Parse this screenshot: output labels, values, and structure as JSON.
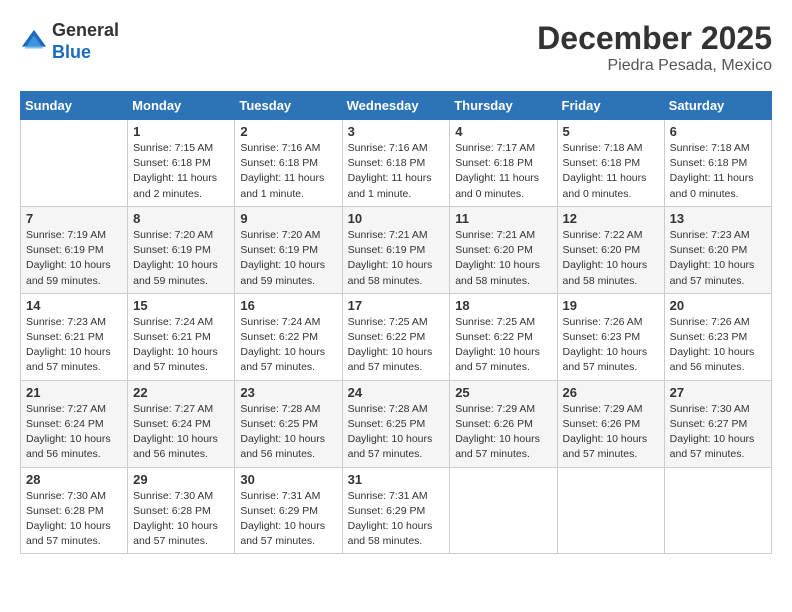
{
  "logo": {
    "general": "General",
    "blue": "Blue"
  },
  "title": "December 2025",
  "location": "Piedra Pesada, Mexico",
  "days_header": [
    "Sunday",
    "Monday",
    "Tuesday",
    "Wednesday",
    "Thursday",
    "Friday",
    "Saturday"
  ],
  "weeks": [
    [
      {
        "day": "",
        "info": ""
      },
      {
        "day": "1",
        "info": "Sunrise: 7:15 AM\nSunset: 6:18 PM\nDaylight: 11 hours\nand 2 minutes."
      },
      {
        "day": "2",
        "info": "Sunrise: 7:16 AM\nSunset: 6:18 PM\nDaylight: 11 hours\nand 1 minute."
      },
      {
        "day": "3",
        "info": "Sunrise: 7:16 AM\nSunset: 6:18 PM\nDaylight: 11 hours\nand 1 minute."
      },
      {
        "day": "4",
        "info": "Sunrise: 7:17 AM\nSunset: 6:18 PM\nDaylight: 11 hours\nand 0 minutes."
      },
      {
        "day": "5",
        "info": "Sunrise: 7:18 AM\nSunset: 6:18 PM\nDaylight: 11 hours\nand 0 minutes."
      },
      {
        "day": "6",
        "info": "Sunrise: 7:18 AM\nSunset: 6:18 PM\nDaylight: 11 hours\nand 0 minutes."
      }
    ],
    [
      {
        "day": "7",
        "info": "Sunrise: 7:19 AM\nSunset: 6:19 PM\nDaylight: 10 hours\nand 59 minutes."
      },
      {
        "day": "8",
        "info": "Sunrise: 7:20 AM\nSunset: 6:19 PM\nDaylight: 10 hours\nand 59 minutes."
      },
      {
        "day": "9",
        "info": "Sunrise: 7:20 AM\nSunset: 6:19 PM\nDaylight: 10 hours\nand 59 minutes."
      },
      {
        "day": "10",
        "info": "Sunrise: 7:21 AM\nSunset: 6:19 PM\nDaylight: 10 hours\nand 58 minutes."
      },
      {
        "day": "11",
        "info": "Sunrise: 7:21 AM\nSunset: 6:20 PM\nDaylight: 10 hours\nand 58 minutes."
      },
      {
        "day": "12",
        "info": "Sunrise: 7:22 AM\nSunset: 6:20 PM\nDaylight: 10 hours\nand 58 minutes."
      },
      {
        "day": "13",
        "info": "Sunrise: 7:23 AM\nSunset: 6:20 PM\nDaylight: 10 hours\nand 57 minutes."
      }
    ],
    [
      {
        "day": "14",
        "info": "Sunrise: 7:23 AM\nSunset: 6:21 PM\nDaylight: 10 hours\nand 57 minutes."
      },
      {
        "day": "15",
        "info": "Sunrise: 7:24 AM\nSunset: 6:21 PM\nDaylight: 10 hours\nand 57 minutes."
      },
      {
        "day": "16",
        "info": "Sunrise: 7:24 AM\nSunset: 6:22 PM\nDaylight: 10 hours\nand 57 minutes."
      },
      {
        "day": "17",
        "info": "Sunrise: 7:25 AM\nSunset: 6:22 PM\nDaylight: 10 hours\nand 57 minutes."
      },
      {
        "day": "18",
        "info": "Sunrise: 7:25 AM\nSunset: 6:22 PM\nDaylight: 10 hours\nand 57 minutes."
      },
      {
        "day": "19",
        "info": "Sunrise: 7:26 AM\nSunset: 6:23 PM\nDaylight: 10 hours\nand 57 minutes."
      },
      {
        "day": "20",
        "info": "Sunrise: 7:26 AM\nSunset: 6:23 PM\nDaylight: 10 hours\nand 56 minutes."
      }
    ],
    [
      {
        "day": "21",
        "info": "Sunrise: 7:27 AM\nSunset: 6:24 PM\nDaylight: 10 hours\nand 56 minutes."
      },
      {
        "day": "22",
        "info": "Sunrise: 7:27 AM\nSunset: 6:24 PM\nDaylight: 10 hours\nand 56 minutes."
      },
      {
        "day": "23",
        "info": "Sunrise: 7:28 AM\nSunset: 6:25 PM\nDaylight: 10 hours\nand 56 minutes."
      },
      {
        "day": "24",
        "info": "Sunrise: 7:28 AM\nSunset: 6:25 PM\nDaylight: 10 hours\nand 57 minutes."
      },
      {
        "day": "25",
        "info": "Sunrise: 7:29 AM\nSunset: 6:26 PM\nDaylight: 10 hours\nand 57 minutes."
      },
      {
        "day": "26",
        "info": "Sunrise: 7:29 AM\nSunset: 6:26 PM\nDaylight: 10 hours\nand 57 minutes."
      },
      {
        "day": "27",
        "info": "Sunrise: 7:30 AM\nSunset: 6:27 PM\nDaylight: 10 hours\nand 57 minutes."
      }
    ],
    [
      {
        "day": "28",
        "info": "Sunrise: 7:30 AM\nSunset: 6:28 PM\nDaylight: 10 hours\nand 57 minutes."
      },
      {
        "day": "29",
        "info": "Sunrise: 7:30 AM\nSunset: 6:28 PM\nDaylight: 10 hours\nand 57 minutes."
      },
      {
        "day": "30",
        "info": "Sunrise: 7:31 AM\nSunset: 6:29 PM\nDaylight: 10 hours\nand 57 minutes."
      },
      {
        "day": "31",
        "info": "Sunrise: 7:31 AM\nSunset: 6:29 PM\nDaylight: 10 hours\nand 58 minutes."
      },
      {
        "day": "",
        "info": ""
      },
      {
        "day": "",
        "info": ""
      },
      {
        "day": "",
        "info": ""
      }
    ]
  ]
}
